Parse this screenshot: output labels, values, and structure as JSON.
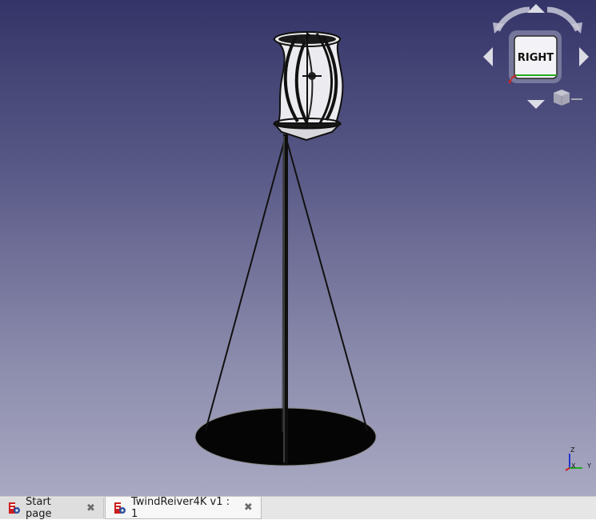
{
  "navcube": {
    "face_label": "RIGHT"
  },
  "axes": {
    "z_label": "Z",
    "x_label": "X",
    "y_label": "Y"
  },
  "tabs": [
    {
      "label": "Start page",
      "close": "✖",
      "active": false
    },
    {
      "label": "TwindReiver4K v1 : 1",
      "close": "✖",
      "active": true
    }
  ],
  "colors": {
    "background_top": "#343468",
    "background_bottom": "#a9a9c3",
    "model_dark": "#1a1a1a",
    "model_light": "#e8e8ec",
    "axis_x": "#cc2222",
    "axis_y": "#22aa22",
    "axis_z": "#2233cc",
    "freecad_red": "#cc1f1f"
  },
  "icons": {
    "tab_icon": "freecad-gear-icon",
    "close_icon": "close-icon"
  }
}
